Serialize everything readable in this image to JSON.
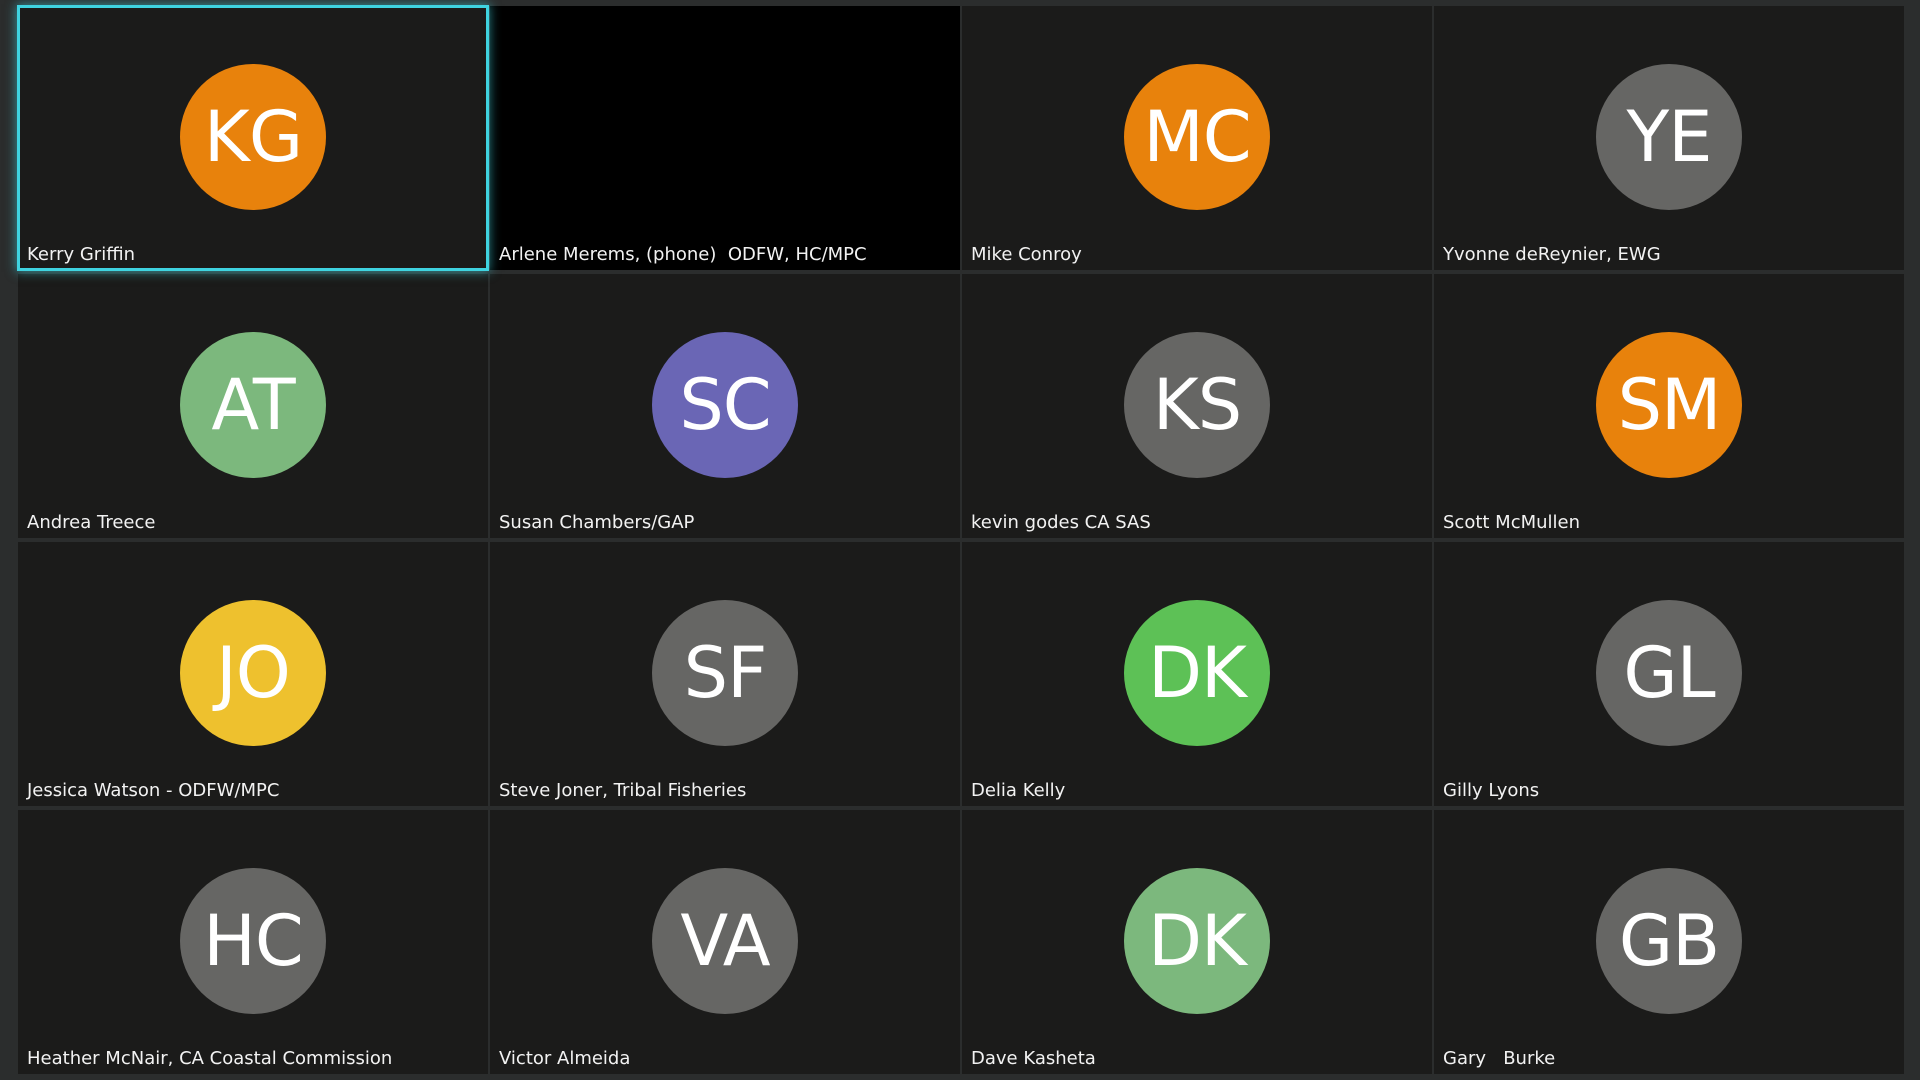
{
  "participants": [
    {
      "name": "Kerry Griffin",
      "initials": "KG",
      "avatar_color": "#e8820c",
      "active_speaker": true
    },
    {
      "name": "Arlene Merems, (phone)  ODFW, HC/MPC",
      "initials": "",
      "avatar_color": "",
      "active_speaker": false
    },
    {
      "name": "Mike Conroy",
      "initials": "MC",
      "avatar_color": "#e8820c",
      "active_speaker": false
    },
    {
      "name": "Yvonne deReynier, EWG",
      "initials": "YE",
      "avatar_color": "#666664",
      "active_speaker": false
    },
    {
      "name": "Andrea Treece",
      "initials": "AT",
      "avatar_color": "#7cb87d",
      "active_speaker": false
    },
    {
      "name": "Susan Chambers/GAP",
      "initials": "SC",
      "avatar_color": "#6a66b5",
      "active_speaker": false
    },
    {
      "name": "kevin godes CA SAS",
      "initials": "KS",
      "avatar_color": "#666664",
      "active_speaker": false
    },
    {
      "name": "Scott McMullen",
      "initials": "SM",
      "avatar_color": "#e8820c",
      "active_speaker": false
    },
    {
      "name": "Jessica Watson - ODFW/MPC",
      "initials": "JO",
      "avatar_color": "#eec12e",
      "active_speaker": false
    },
    {
      "name": "Steve Joner, Tribal Fisheries",
      "initials": "SF",
      "avatar_color": "#666664",
      "active_speaker": false
    },
    {
      "name": "Delia Kelly",
      "initials": "DK",
      "avatar_color": "#5dc156",
      "active_speaker": false
    },
    {
      "name": "Gilly Lyons",
      "initials": "GL",
      "avatar_color": "#666664",
      "active_speaker": false
    },
    {
      "name": "Heather McNair, CA Coastal Commission",
      "initials": "HC",
      "avatar_color": "#666664",
      "active_speaker": false
    },
    {
      "name": "Victor Almeida",
      "initials": "VA",
      "avatar_color": "#666664",
      "active_speaker": false
    },
    {
      "name": "Dave Kasheta",
      "initials": "DK",
      "avatar_color": "#7cb87d",
      "active_speaker": false
    },
    {
      "name": "Gary   Burke",
      "initials": "GB",
      "avatar_color": "#666664",
      "active_speaker": false
    }
  ]
}
